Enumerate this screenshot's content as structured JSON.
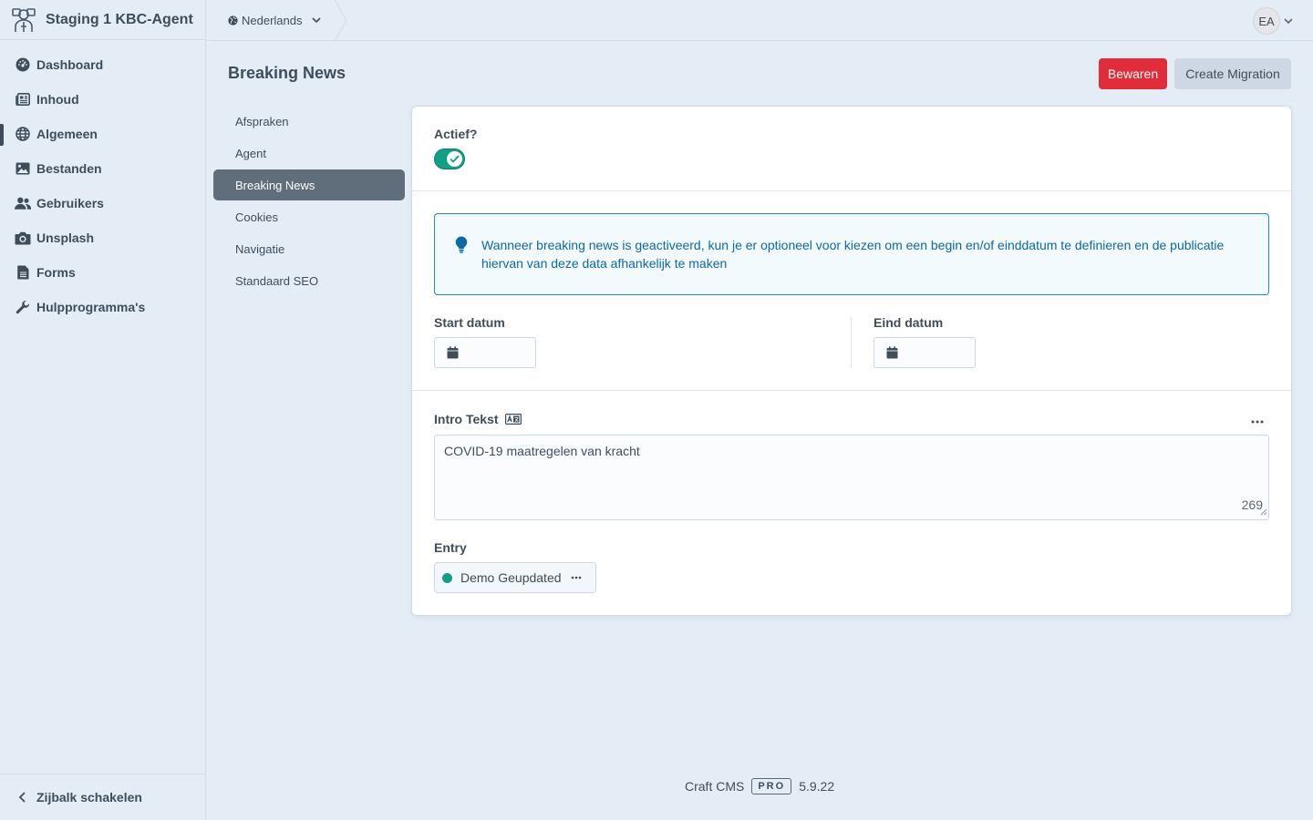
{
  "site": {
    "name": "Staging 1 KBC-Agent"
  },
  "nav": {
    "items": [
      {
        "label": "Dashboard",
        "icon": "dashboard-gauge-icon"
      },
      {
        "label": "Inhoud",
        "icon": "newspaper-icon"
      },
      {
        "label": "Algemeen",
        "icon": "globe-icon",
        "active": true
      },
      {
        "label": "Bestanden",
        "icon": "image-icon"
      },
      {
        "label": "Gebruikers",
        "icon": "users-icon"
      },
      {
        "label": "Unsplash",
        "icon": "camera-icon"
      },
      {
        "label": "Forms",
        "icon": "file-text-icon"
      },
      {
        "label": "Hulpprogramma's",
        "icon": "wrench-icon"
      }
    ],
    "collapse_label": "Zijbalk schakelen"
  },
  "topbar": {
    "site_menu_label": "Nederlands",
    "user_initials": "EA"
  },
  "page": {
    "title": "Breaking News",
    "save_label": "Bewaren",
    "migration_label": "Create Migration"
  },
  "subnav": {
    "items": [
      {
        "label": "Afspraken"
      },
      {
        "label": "Agent"
      },
      {
        "label": "Breaking News",
        "selected": true
      },
      {
        "label": "Cookies"
      },
      {
        "label": "Navigatie"
      },
      {
        "label": "Standaard SEO"
      }
    ]
  },
  "form": {
    "active_label": "Actief?",
    "active_value": true,
    "tip": "Wanneer breaking news is geactiveerd, kun je er optioneel voor kiezen om een begin en/of einddatum te definieren en de publicatie hiervan van deze data afhankelijk te maken",
    "start_label": "Start datum",
    "end_label": "Eind datum",
    "intro_label": "Intro Tekst",
    "intro_value": "COVID-19 maatregelen van kracht",
    "intro_remaining": "269",
    "entry_label": "Entry",
    "entry_title": "Demo Geupdated",
    "entry_status_color": "#10a085"
  },
  "footer": {
    "product": "Craft CMS",
    "edition": "PRO",
    "version": "5.9.22"
  },
  "colors": {
    "accent_red": "#e12d39",
    "enabled_green": "#10a085",
    "tip_blue": "#0b69a3"
  }
}
